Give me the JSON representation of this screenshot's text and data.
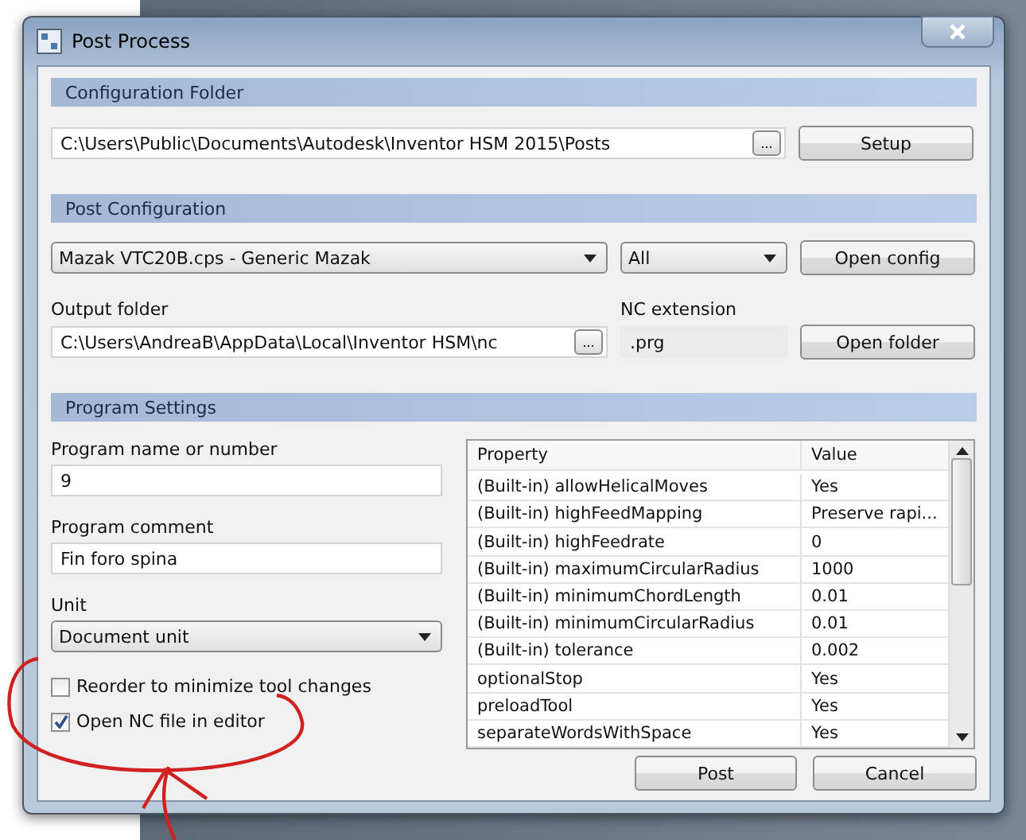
{
  "window": {
    "title": "Post Process"
  },
  "configuration_folder": {
    "heading": "Configuration Folder",
    "path": "C:\\Users\\Public\\Documents\\Autodesk\\Inventor HSM 2015\\Posts",
    "browse_button": "...",
    "setup_button": "Setup"
  },
  "post_configuration": {
    "heading": "Post Configuration",
    "post": "Mazak VTC20B.cps - Generic Mazak",
    "filter": "All",
    "open_config_button": "Open config",
    "output_folder_label": "Output folder",
    "output_folder": "C:\\Users\\AndreaB\\AppData\\Local\\Inventor HSM\\nc",
    "browse_button": "...",
    "nc_extension_label": "NC extension",
    "nc_extension": ".prg",
    "open_folder_button": "Open folder"
  },
  "program_settings": {
    "heading": "Program Settings",
    "name_label": "Program name or number",
    "name": "9",
    "comment_label": "Program comment",
    "comment": "Fin foro spina",
    "unit_label": "Unit",
    "unit": "Document unit",
    "options": [
      {
        "label": "Reorder to minimize tool changes",
        "checked": false
      },
      {
        "label": "Open NC file in editor",
        "checked": true
      }
    ]
  },
  "properties": {
    "columns": [
      "Property",
      "Value"
    ],
    "rows": [
      {
        "property": "(Built-in) allowHelicalMoves",
        "value": "Yes"
      },
      {
        "property": "(Built-in) highFeedMapping",
        "value": "Preserve rapi..."
      },
      {
        "property": "(Built-in) highFeedrate",
        "value": "0"
      },
      {
        "property": "(Built-in) maximumCircularRadius",
        "value": "1000"
      },
      {
        "property": "(Built-in) minimumChordLength",
        "value": "0.01"
      },
      {
        "property": "(Built-in) minimumCircularRadius",
        "value": "0.01"
      },
      {
        "property": "(Built-in) tolerance",
        "value": "0.002"
      },
      {
        "property": "optionalStop",
        "value": "Yes"
      },
      {
        "property": "preloadTool",
        "value": "Yes"
      },
      {
        "property": "separateWordsWithSpace",
        "value": "Yes"
      }
    ]
  },
  "buttons": [
    "Post",
    "Cancel"
  ]
}
